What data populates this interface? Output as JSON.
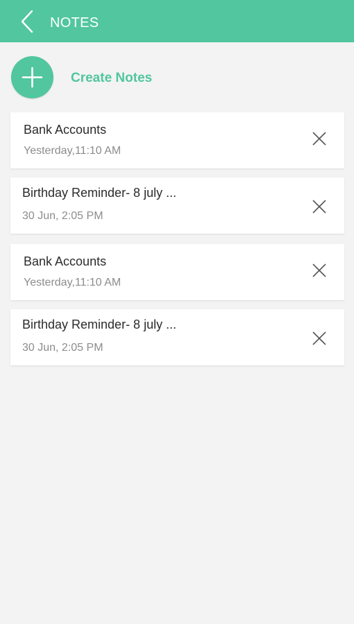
{
  "app_bar": {
    "title": "NOTES",
    "back_icon": "chevron-left-icon",
    "background_color": "#51c69f"
  },
  "create": {
    "label": "Create Notes",
    "icon": "plus-icon",
    "accent_color": "#51c69f"
  },
  "notes": [
    {
      "title": "Bank Accounts",
      "time": "Yesterday,11:10 AM",
      "delete_icon": "close-icon"
    },
    {
      "title": "Birthday Reminder- 8 july ...",
      "time": "30 Jun, 2:05 PM",
      "delete_icon": "close-icon"
    },
    {
      "title": "Bank Accounts",
      "time": "Yesterday,11:10 AM",
      "delete_icon": "close-icon"
    },
    {
      "title": "Birthday Reminder- 8 july ...",
      "time": "30 Jun, 2:05 PM",
      "delete_icon": "close-icon"
    }
  ]
}
